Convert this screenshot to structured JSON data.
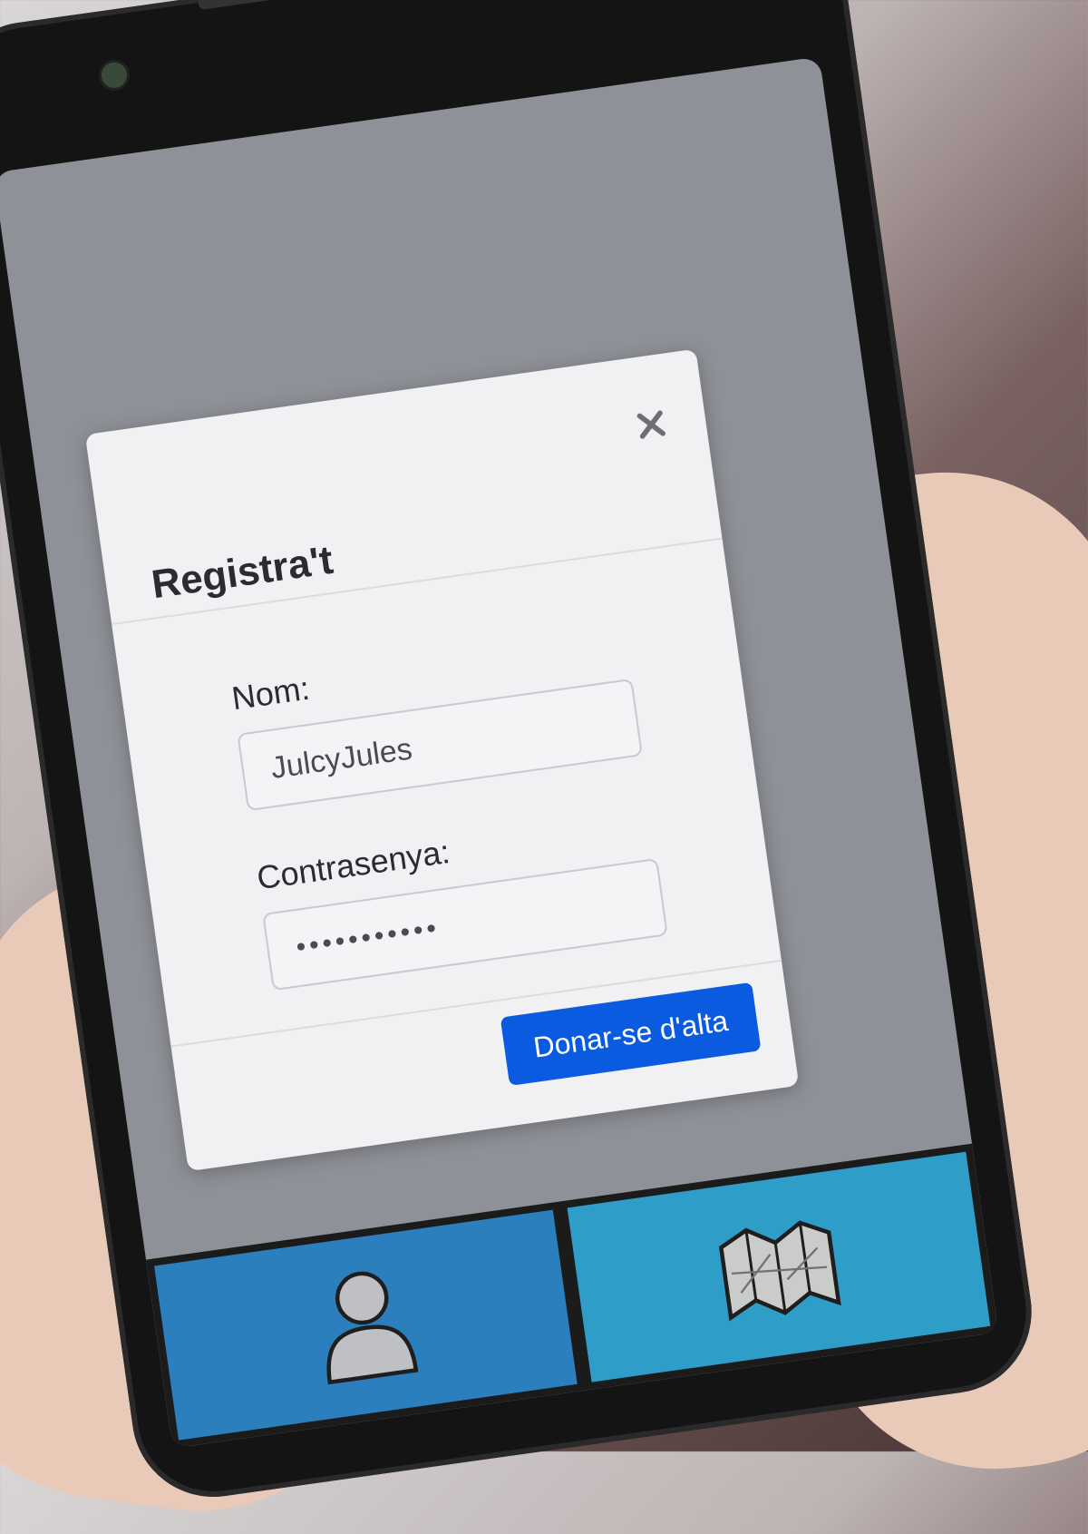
{
  "modal": {
    "title": "Registra't",
    "close_symbol": "✕",
    "name_label": "Nom:",
    "name_value": "JulcyJules",
    "password_label": "Contrasenya:",
    "password_value": "•••••••••••",
    "submit_label": "Donar-se d'alta"
  },
  "tabbar": {
    "tabs": [
      {
        "icon": "user-icon"
      },
      {
        "icon": "map-icon"
      }
    ]
  },
  "colors": {
    "accent": "#0a5be0",
    "tab_user": "#2c7fbd",
    "tab_map": "#2e9ec9",
    "modal_bg": "#f1f1f4"
  }
}
